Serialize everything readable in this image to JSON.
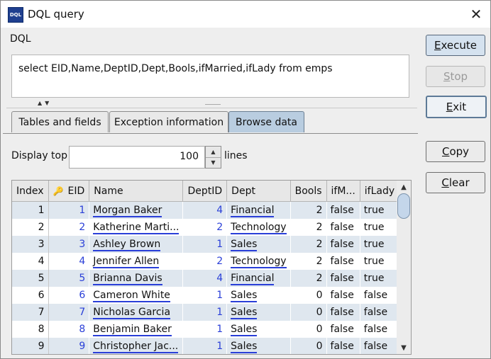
{
  "window": {
    "title": "DQL query",
    "app_icon_text": "DQL"
  },
  "dql": {
    "label": "DQL",
    "query": "select EID,Name,DeptID,Dept,Bools,ifMarried,ifLady from emps"
  },
  "tabs": [
    {
      "label": "Tables and fields",
      "active": false
    },
    {
      "label": "Exception information",
      "active": false
    },
    {
      "label": "Browse data",
      "active": true
    }
  ],
  "browse": {
    "display_top_label": "Display top",
    "display_top_value": "100",
    "lines_label": "lines"
  },
  "grid": {
    "columns": [
      "Index",
      "EID",
      "Name",
      "DeptID",
      "Dept",
      "Bools",
      "ifM...",
      "ifLady"
    ],
    "rows": [
      [
        "1",
        "1",
        "Morgan Baker",
        "4",
        "Financial",
        "2",
        "false",
        "true"
      ],
      [
        "2",
        "2",
        "Katherine Marti...",
        "2",
        "Technology",
        "2",
        "false",
        "true"
      ],
      [
        "3",
        "3",
        "Ashley Brown",
        "1",
        "Sales",
        "2",
        "false",
        "true"
      ],
      [
        "4",
        "4",
        "Jennifer Allen",
        "2",
        "Technology",
        "2",
        "false",
        "true"
      ],
      [
        "5",
        "5",
        "Brianna Davis",
        "4",
        "Financial",
        "2",
        "false",
        "true"
      ],
      [
        "6",
        "6",
        "Cameron White",
        "1",
        "Sales",
        "0",
        "false",
        "false"
      ],
      [
        "7",
        "7",
        "Nicholas Garcia",
        "1",
        "Sales",
        "0",
        "false",
        "false"
      ],
      [
        "8",
        "8",
        "Benjamin Baker",
        "1",
        "Sales",
        "0",
        "false",
        "false"
      ],
      [
        "9",
        "9",
        "Christopher Jac...",
        "1",
        "Sales",
        "0",
        "false",
        "false"
      ]
    ]
  },
  "buttons": {
    "execute": "Execute",
    "stop": "Stop",
    "exit": "Exit",
    "copy": "Copy",
    "clear": "Clear"
  },
  "colors": {
    "active_tab": "#b9cde0",
    "odd_row": "#dfe7ef",
    "link_underline": "#2a3fd8",
    "number_blue": "#2a3fd8"
  }
}
